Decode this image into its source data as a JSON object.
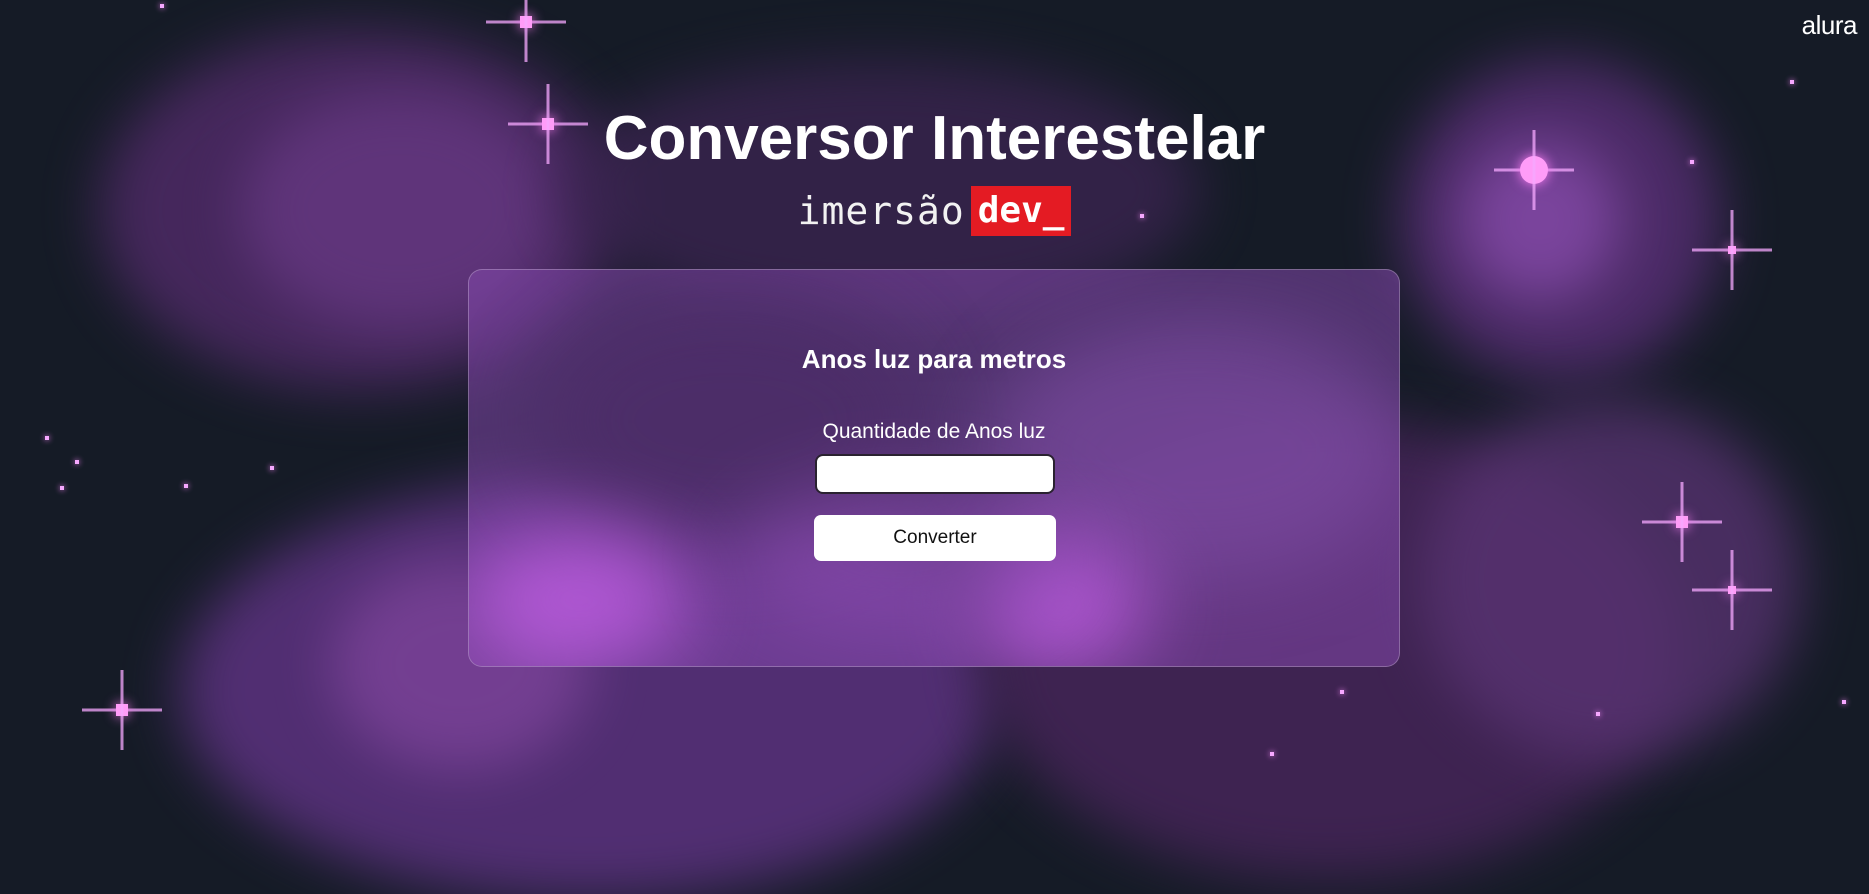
{
  "brand": {
    "logo_text": "alura"
  },
  "header": {
    "title": "Conversor Interestelar",
    "tagline_prefix": "imersão",
    "tagline_badge": "dev_"
  },
  "card": {
    "title": "Anos luz para metros",
    "input_label": "Quantidade de Anos luz",
    "input_value": "",
    "button_label": "Converter"
  },
  "colors": {
    "background": "#151b26",
    "nebula": "#6b3a8f",
    "badge_red": "#e41b23",
    "card_tint": "#8448ac"
  }
}
